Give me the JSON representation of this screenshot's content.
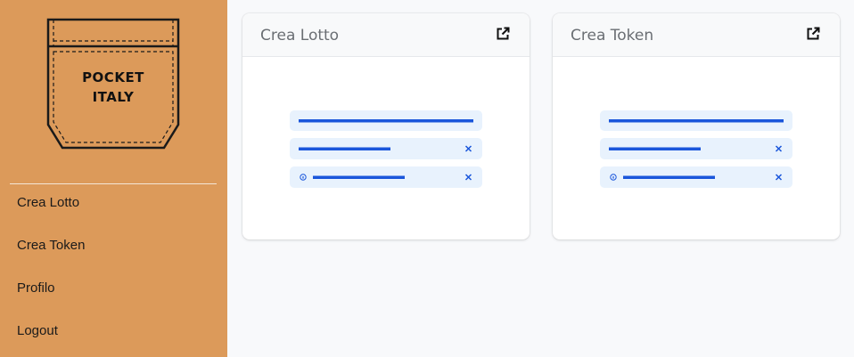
{
  "sidebar": {
    "logo_lines": [
      "POCKET",
      "ITALY"
    ],
    "items": [
      {
        "label": "Crea Lotto"
      },
      {
        "label": "Crea Token"
      },
      {
        "label": "Profilo"
      },
      {
        "label": "Logout"
      }
    ]
  },
  "cards": [
    {
      "title": "Crea Lotto",
      "icon": "external-link-icon"
    },
    {
      "title": "Crea Token",
      "icon": "external-link-icon"
    }
  ],
  "colors": {
    "sidebar_bg": "#dc9a5a",
    "accent": "#1a56db",
    "placeholder_bg": "#e8f2fd"
  }
}
